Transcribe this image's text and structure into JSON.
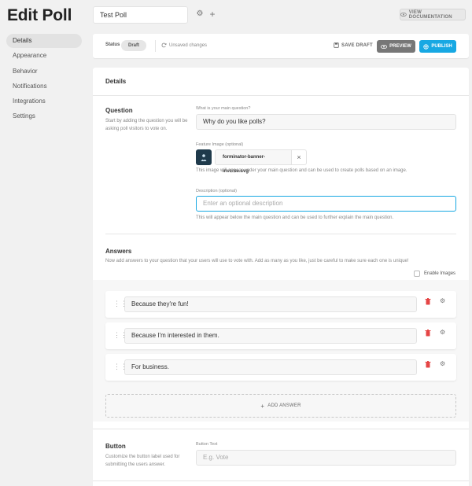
{
  "header": {
    "title": "Edit Poll",
    "poll_name": "Test Poll",
    "view_docs_label": "VIEW DOCUMENTATION"
  },
  "sidebar": {
    "items": [
      {
        "label": "Details",
        "active": true
      },
      {
        "label": "Appearance"
      },
      {
        "label": "Behavior"
      },
      {
        "label": "Notifications"
      },
      {
        "label": "Integrations"
      },
      {
        "label": "Settings"
      }
    ]
  },
  "status_bar": {
    "status_label": "Status",
    "status_value": "Draft",
    "unsaved_text": "Unsaved changes",
    "save_draft_label": "SAVE DRAFT",
    "preview_label": "PREVIEW",
    "publish_label": "PUBLISH"
  },
  "details": {
    "title": "Details",
    "question": {
      "title": "Question",
      "description": "Start by adding the question you will be asking poll visitors to vote on.",
      "main_label": "What is your main question?",
      "main_value": "Why do you like polls?",
      "feature_label": "Feature Image (optional)",
      "file_name": "forminator-banner-inverse.svg",
      "feature_help": "This image will appear under your main question and can be used to create polls based on an image.",
      "desc_label": "Description (optional)",
      "desc_placeholder": "Enter an optional description",
      "desc_help": "This will appear below the main question and can be used to further explain the main question."
    },
    "answers": {
      "title": "Answers",
      "description": "Now add answers to your question that your users will use to vote with. Add as many as you like, just be careful to make sure each one is unique!",
      "enable_images_label": "Enable Images",
      "items": [
        {
          "value": "Because they're fun!"
        },
        {
          "value": "Because I'm interested in them."
        },
        {
          "value": "For business."
        }
      ],
      "add_label": "ADD ANSWER"
    },
    "button": {
      "title": "Button",
      "description": "Customize the button label used for submitting the users answer.",
      "text_label": "Button Text",
      "text_placeholder": "E.g. Vote"
    }
  },
  "colors": {
    "accent": "#17a8e3",
    "preview": "#777777",
    "danger": "#e54545"
  }
}
